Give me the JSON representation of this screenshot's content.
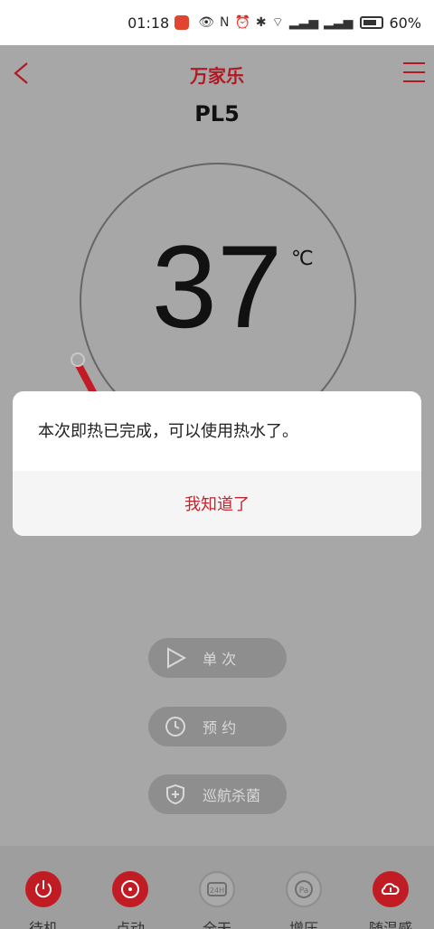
{
  "status": {
    "time": "01:18",
    "battery": "60%"
  },
  "app": {
    "brand": "万家乐",
    "device_name": "PL5"
  },
  "temperature": {
    "value": "37",
    "unit": "℃"
  },
  "dialog": {
    "message": "本次即热已完成，可以使用热水了。",
    "button": "我知道了"
  },
  "modes": [
    {
      "label": "单  次"
    },
    {
      "label": "预  约"
    },
    {
      "label": "巡航杀菌"
    }
  ],
  "bottom_nav": [
    {
      "label": "待机"
    },
    {
      "label": "点动"
    },
    {
      "label": "全天"
    },
    {
      "label": "增压"
    },
    {
      "label": "随温感"
    }
  ],
  "colors": {
    "accent": "#c0262f",
    "modal_bg": "#ffffff",
    "page_bg": "#a7a7a7"
  }
}
